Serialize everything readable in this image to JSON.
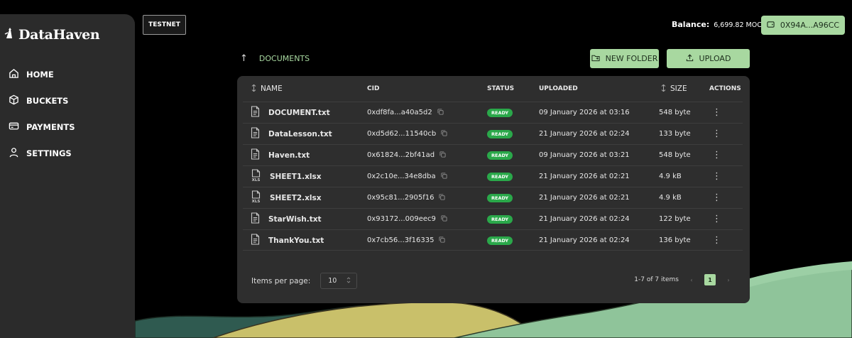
{
  "brand": {
    "name": "DataHaven"
  },
  "sidebar": {
    "items": [
      {
        "label": "HOME",
        "icon": "home-icon"
      },
      {
        "label": "BUCKETS",
        "icon": "cube-icon"
      },
      {
        "label": "PAYMENTS",
        "icon": "card-icon"
      },
      {
        "label": "SETTINGS",
        "icon": "user-icon"
      }
    ]
  },
  "header": {
    "network": "TESTNET",
    "balance_label": "Balance:",
    "balance_value": "6,699.82 MOCK",
    "wallet": "0X94A...A96CC"
  },
  "breadcrumb": {
    "current": "DOCUMENTS"
  },
  "toolbar": {
    "new_folder": "NEW FOLDER",
    "upload": "UPLOAD"
  },
  "table": {
    "columns": {
      "name": "NAME",
      "cid": "CID",
      "status": "STATUS",
      "uploaded": "UPLOADED",
      "size": "SIZE",
      "actions": "ACTIONS"
    },
    "rows": [
      {
        "name": "DOCUMENT.txt",
        "type": "txt",
        "cid": "0xdf8fa...a40a5d2",
        "status": "READY",
        "uploaded": "09 January 2026 at 03:16",
        "size": "548 byte"
      },
      {
        "name": "DataLesson.txt",
        "type": "txt",
        "cid": "0xd5d62...11540cb",
        "status": "READY",
        "uploaded": "21 January 2026 at 02:24",
        "size": "133 byte"
      },
      {
        "name": "Haven.txt",
        "type": "txt",
        "cid": "0x61824...2bf41ad",
        "status": "READY",
        "uploaded": "09 January 2026 at 03:21",
        "size": "548 byte"
      },
      {
        "name": "SHEET1.xlsx",
        "type": "xls",
        "cid": "0x2c10e...34e8dba",
        "status": "READY",
        "uploaded": "21 January 2026 at 02:21",
        "size": "4.9 kB"
      },
      {
        "name": "SHEET2.xlsx",
        "type": "xls",
        "cid": "0x95c81...2905f16",
        "status": "READY",
        "uploaded": "21 January 2026 at 02:21",
        "size": "4.9 kB"
      },
      {
        "name": "StarWish.txt",
        "type": "txt",
        "cid": "0x93172...009eec9",
        "status": "READY",
        "uploaded": "21 January 2026 at 02:24",
        "size": "122 byte"
      },
      {
        "name": "ThankYou.txt",
        "type": "txt",
        "cid": "0x7cb56...3f16335",
        "status": "READY",
        "uploaded": "21 January 2026 at 02:24",
        "size": "136 byte"
      }
    ]
  },
  "pagination": {
    "items_per_page_label": "Items per page:",
    "items_per_page": "10",
    "range": "1-7 of 7 items",
    "current_page": "1"
  },
  "colors": {
    "accent": "#a8d8a0",
    "ready": "#2aa84a",
    "panel": "#2e2e2e"
  }
}
